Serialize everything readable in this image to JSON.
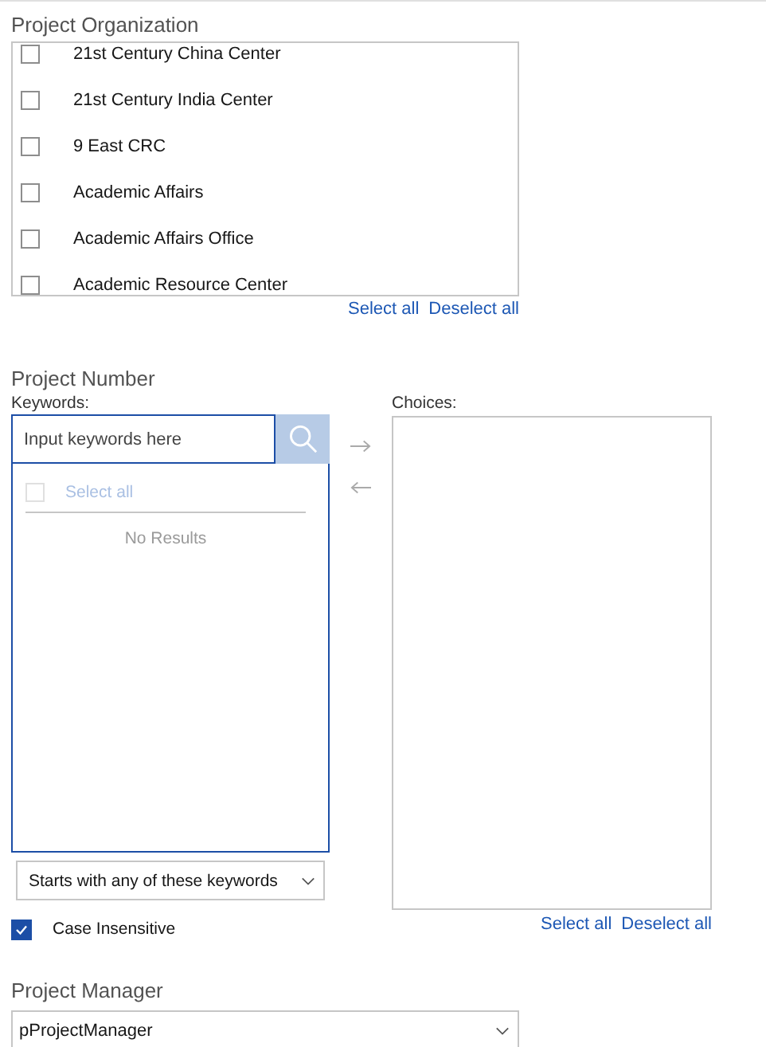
{
  "project_organization": {
    "label": "Project Organization",
    "items": [
      {
        "label": "21st Century China Center",
        "checked": false
      },
      {
        "label": "21st Century India Center",
        "checked": false
      },
      {
        "label": "9 East CRC",
        "checked": false
      },
      {
        "label": "Academic Affairs",
        "checked": false
      },
      {
        "label": "Academic Affairs Office",
        "checked": false
      },
      {
        "label": "Academic Resource Center",
        "checked": false
      }
    ],
    "select_all": "Select all",
    "deselect_all": "Deselect all"
  },
  "project_number": {
    "label": "Project Number",
    "keywords_label": "Keywords:",
    "search": {
      "placeholder": "Input keywords here"
    },
    "results": {
      "select_all": {
        "label": "Select all",
        "checked": false,
        "disabled": true
      },
      "empty_text": "No Results"
    },
    "match_mode": "Starts with any of these keywords",
    "case_insensitive": {
      "label": "Case Insensitive",
      "checked": true
    },
    "choices_label": "Choices:",
    "choices_select_all": "Select all",
    "choices_deselect_all": "Deselect all"
  },
  "project_manager": {
    "label": "Project Manager",
    "value": "pProjectManager"
  }
}
